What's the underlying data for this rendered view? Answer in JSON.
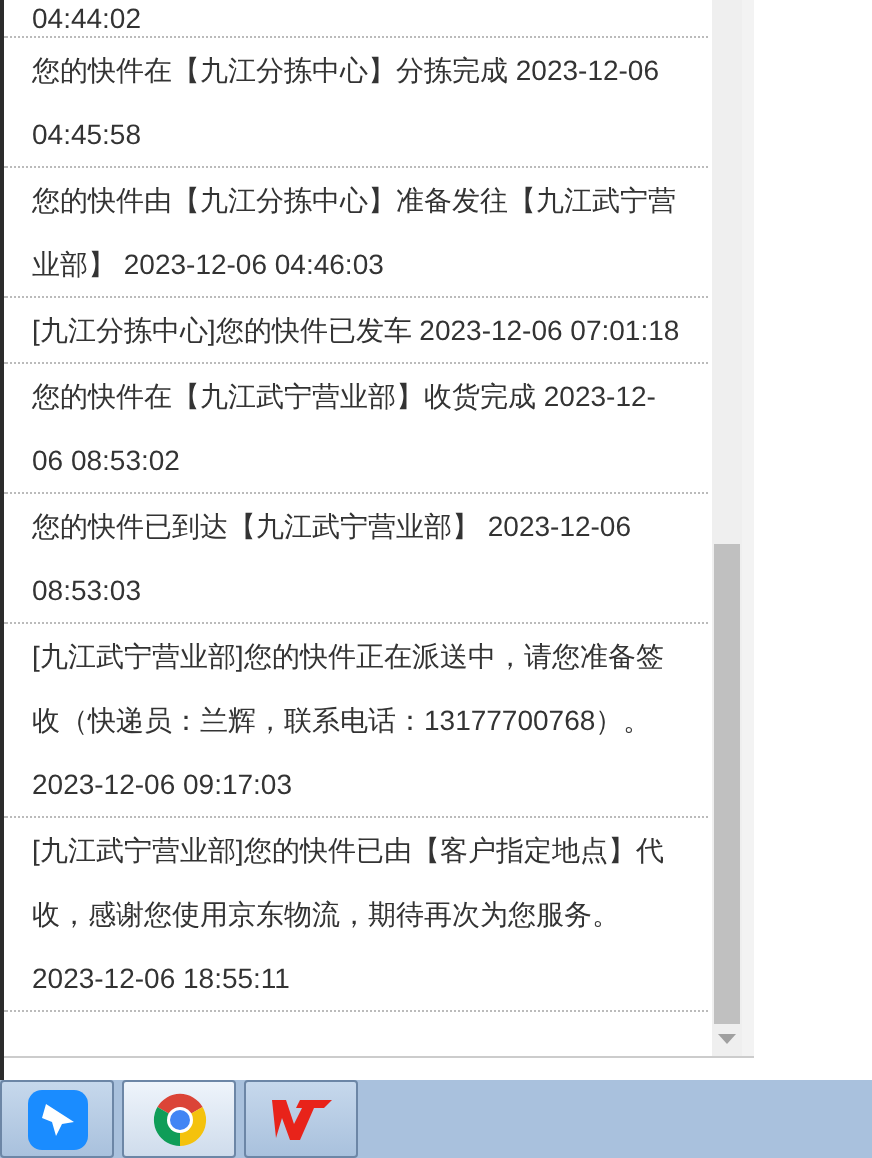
{
  "events": [
    {
      "text": "04:44:02"
    },
    {
      "text": "您的快件在【九江分拣中心】分拣完成 2023-12-06 04:45:58"
    },
    {
      "text": "您的快件由【九江分拣中心】准备发往【九江武宁营业部】 2023-12-06 04:46:03"
    },
    {
      "text": "[九江分拣中心]您的快件已发车 2023-12-06 07:01:18"
    },
    {
      "text": "您的快件在【九江武宁营业部】收货完成 2023-12-06 08:53:02"
    },
    {
      "text": "您的快件已到达【九江武宁营业部】 2023-12-06 08:53:03"
    },
    {
      "text": "[九江武宁营业部]您的快件正在派送中，请您准备签收（快递员：兰辉，联系电话：13177700768）。 2023-12-06 09:17:03"
    },
    {
      "text": "[九江武宁营业部]您的快件已由【客户指定地点】代收，感谢您使用京东物流，期待再次为您服务。 2023-12-06 18:55:11"
    }
  ],
  "taskbar": {
    "apps": [
      {
        "kind": "messenger",
        "selected": false
      },
      {
        "kind": "browser",
        "selected": true
      },
      {
        "kind": "office",
        "selected": false
      }
    ]
  }
}
